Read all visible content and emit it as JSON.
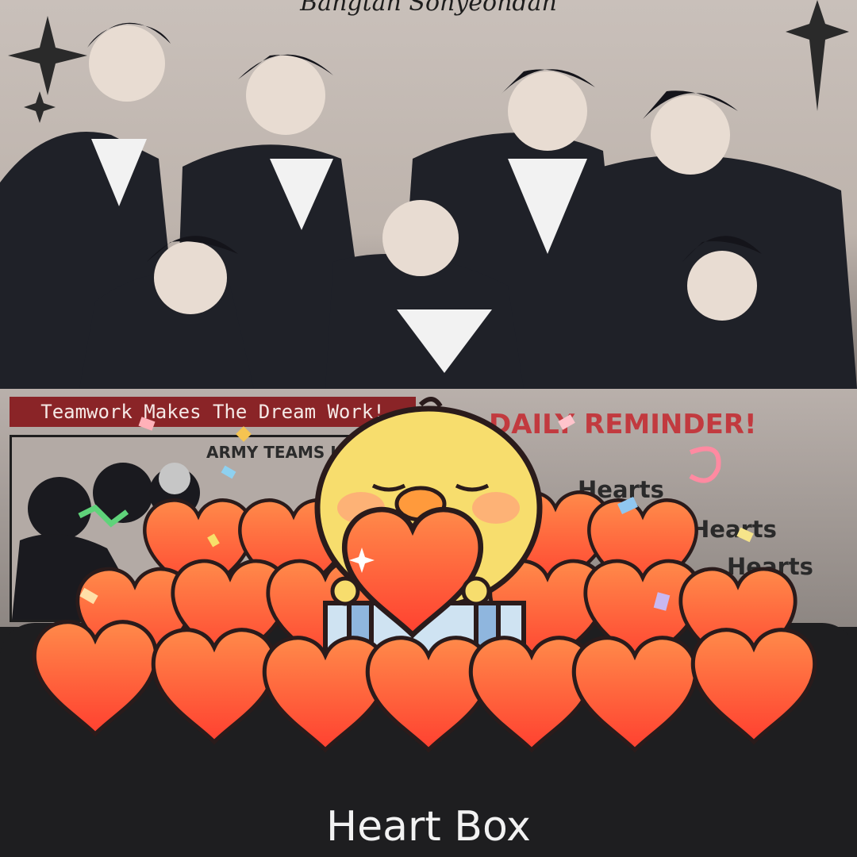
{
  "photo": {
    "caption": "Bangtan Sonyeondan"
  },
  "poster": {
    "banner": "Teamwork Makes The Dream Work!",
    "panel_title": "ARMY TEAMS U",
    "headline": "DAILY REMINDER!",
    "lines": [
      "Hearts",
      "Hearts",
      "Hearts"
    ]
  },
  "sheet": {
    "title": "Heart Box"
  },
  "colors": {
    "heart_fill": "#ff5f3a",
    "heart_outline": "#2a1b1b",
    "chick_fill": "#f7dd6d",
    "sheet_bg": "#1e1e20"
  },
  "icons": [
    "sparkle-icon",
    "chick-icon",
    "heart-icon",
    "confetti-icon",
    "gift-box-icon"
  ]
}
